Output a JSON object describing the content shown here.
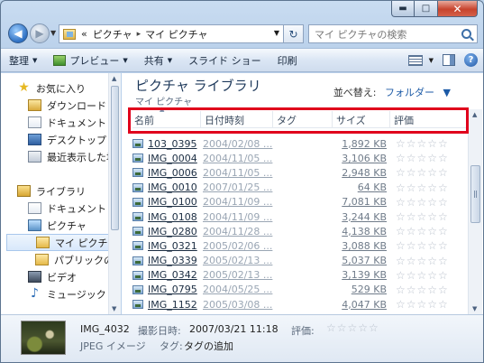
{
  "window": {
    "caption": {
      "minimize": "▬",
      "maximize": "□",
      "close": "✕"
    }
  },
  "address": {
    "overflow": "«",
    "crumbs": [
      "ピクチャ",
      "マイ ピクチャ"
    ],
    "separator": "▸",
    "search_placeholder": "マイ ピクチャの検索"
  },
  "toolbar": {
    "organize": "整理",
    "preview": "プレビュー",
    "share": "共有",
    "slideshow": "スライド ショー",
    "print": "印刷"
  },
  "sidebar": {
    "items": [
      {
        "label": "お気に入り",
        "icon": "star-icon"
      },
      {
        "label": "ダウンロード",
        "icon": "downloads-folder-icon"
      },
      {
        "label": "ドキュメント",
        "icon": "documents-icon"
      },
      {
        "label": "デスクトップ",
        "icon": "desktop-icon"
      },
      {
        "label": "最近表示した場所",
        "icon": "recent-places-icon"
      },
      {
        "label": "ライブラリ",
        "icon": "library-icon"
      },
      {
        "label": "ドキュメント",
        "icon": "documents-library-icon"
      },
      {
        "label": "ピクチャ",
        "icon": "pictures-library-icon"
      },
      {
        "label": "マイ ピクチャ",
        "icon": "folder-icon"
      },
      {
        "label": "パブリックのピ",
        "icon": "folder-icon"
      },
      {
        "label": "ビデオ",
        "icon": "videos-library-icon"
      },
      {
        "label": "ミュージック",
        "icon": "music-library-icon"
      }
    ]
  },
  "library": {
    "title": "ピクチャ ライブラリ",
    "subtitle": "マイ ピクチャ",
    "arrange_label": "並べ替え:",
    "arrange_value": "フォルダー"
  },
  "columns": {
    "name": "名前",
    "date": "日付時刻",
    "tags": "タグ",
    "size": "サイズ",
    "rating": "評価"
  },
  "files": [
    {
      "name": "103_0395",
      "date": "2004/02/08 ...",
      "size": "1,892 KB"
    },
    {
      "name": "IMG_0004",
      "date": "2004/11/05 ...",
      "size": "3,106 KB"
    },
    {
      "name": "IMG_0006",
      "date": "2004/11/05 ...",
      "size": "2,948 KB"
    },
    {
      "name": "IMG_0010",
      "date": "2007/01/25 ...",
      "size": "64 KB"
    },
    {
      "name": "IMG_0100",
      "date": "2004/11/09 ...",
      "size": "7,081 KB"
    },
    {
      "name": "IMG_0108",
      "date": "2004/11/09 ...",
      "size": "3,244 KB"
    },
    {
      "name": "IMG_0280",
      "date": "2004/11/28 ...",
      "size": "4,138 KB"
    },
    {
      "name": "IMG_0321",
      "date": "2005/02/06 ...",
      "size": "3,088 KB"
    },
    {
      "name": "IMG_0339",
      "date": "2005/02/13 ...",
      "size": "5,037 KB"
    },
    {
      "name": "IMG_0342",
      "date": "2005/02/13 ...",
      "size": "3,139 KB"
    },
    {
      "name": "IMG_0795",
      "date": "2004/05/25 ...",
      "size": "529 KB"
    },
    {
      "name": "IMG_1152",
      "date": "2005/03/08 ...",
      "size": "4,047 KB"
    }
  ],
  "details": {
    "name": "IMG_4032",
    "type": "JPEG イメージ",
    "date_label": "撮影日時:",
    "date_value": "2007/03/21 11:18",
    "tags_label": "タグ:",
    "tags_value": "タグの追加",
    "rating_label": "評価:"
  },
  "colors": {
    "highlight_box": "#e0001c",
    "title": "#1e395b",
    "link": "#1c5aa6"
  }
}
